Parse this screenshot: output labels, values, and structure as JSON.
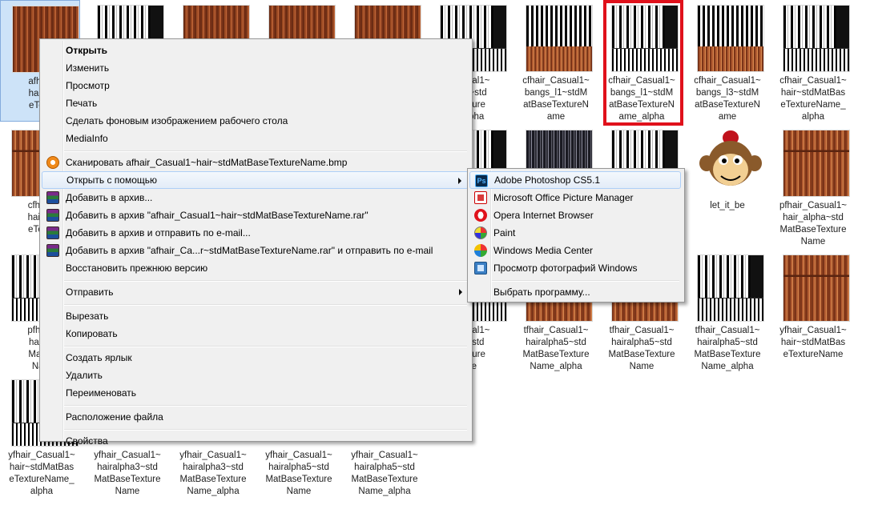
{
  "files": [
    {
      "col": 0,
      "row": 0,
      "name": "afhair_Casual1~hair~stdMatBaseTextureName",
      "caption": [
        "afhair_",
        "hair~st",
        "eTextu"
      ],
      "thumb": "hair",
      "selected": true
    },
    {
      "col": 1,
      "row": 0,
      "name": "",
      "caption": [],
      "thumb": "alpha"
    },
    {
      "col": 2,
      "row": 0,
      "name": "",
      "caption": [],
      "thumb": "hair"
    },
    {
      "col": 3,
      "row": 0,
      "name": "",
      "caption": [],
      "thumb": "hair"
    },
    {
      "col": 4,
      "row": 0,
      "name": "",
      "caption": [],
      "thumb": "hair"
    },
    {
      "col": 5,
      "row": 0,
      "name": "",
      "caption": [
        "Casual1~",
        "ha5~std",
        "Texture",
        "_alpha"
      ],
      "thumb": "alpha"
    },
    {
      "col": 6,
      "row": 0,
      "name": "cfhair_Casual1~bangs_l1~stdMatBaseTextureName",
      "caption": [
        "cfhair_Casual1~",
        "bangs_l1~stdM",
        "atBaseTextureN",
        "ame"
      ],
      "thumb": "mixed"
    },
    {
      "col": 7,
      "row": 0,
      "name": "cfhair_Casual1~bangs_l1~stdMatBaseTextureName_alpha",
      "caption": [
        "cfhair_Casual1~",
        "bangs_l1~stdM",
        "atBaseTextureN",
        "ame_alpha"
      ],
      "thumb": "alpha"
    },
    {
      "col": 8,
      "row": 0,
      "name": "cfhair_Casual1~bangs_l3~stdMatBaseTextureName",
      "caption": [
        "cfhair_Casual1~",
        "bangs_l3~stdM",
        "atBaseTextureN",
        "ame"
      ],
      "thumb": "mixed"
    },
    {
      "col": 9,
      "row": 0,
      "name": "cfhair_Casual1~hair~stdMatBaseTextureName_alpha",
      "caption": [
        "cfhair_Casual1~",
        "hair~stdMatBas",
        "eTextureName_",
        "alpha"
      ],
      "thumb": "alpha"
    },
    {
      "col": 0,
      "row": 1,
      "name": "",
      "caption": [
        "cfhair_",
        "hair~st",
        "eTextu"
      ],
      "thumb": "hair2"
    },
    {
      "col": 5,
      "row": 1,
      "name": "",
      "caption": [],
      "thumb": "alpha"
    },
    {
      "col": 6,
      "row": 1,
      "name": "",
      "caption": [],
      "thumb": "dark"
    },
    {
      "col": 7,
      "row": 1,
      "name": "",
      "caption": [],
      "thumb": "alpha"
    },
    {
      "col": 8,
      "row": 1,
      "name": "let_it_be",
      "caption": [
        "let_it_be"
      ],
      "thumb": "monkey"
    },
    {
      "col": 9,
      "row": 1,
      "name": "pfhair_Casual1~hair_alpha~stdMatBaseTextureName",
      "caption": [
        "pfhair_Casual1~",
        "hair_alpha~std",
        "MatBaseTexture",
        "Name"
      ],
      "thumb": "hair2"
    },
    {
      "col": 0,
      "row": 2,
      "name": "",
      "caption": [
        "pfhair_",
        "hair_a",
        "MatBa",
        "Nam"
      ],
      "thumb": "alpha"
    },
    {
      "col": 5,
      "row": 2,
      "name": "",
      "caption": [
        "Casual1~",
        "a3~std",
        "Texture",
        "me"
      ],
      "thumb": "alpha"
    },
    {
      "col": 6,
      "row": 2,
      "name": "tfhair_Casual1~hairalpha5~stdMatBaseTextureName_alpha",
      "caption": [
        "tfhair_Casual1~",
        "hairalpha5~std",
        "MatBaseTexture",
        "Name_alpha"
      ],
      "thumb": "hair2"
    },
    {
      "col": 7,
      "row": 2,
      "name": "tfhair_Casual1~hairalpha5~stdMatBaseTextureName",
      "caption": [
        "tfhair_Casual1~",
        "hairalpha5~std",
        "MatBaseTexture",
        "Name"
      ],
      "thumb": "hair2"
    },
    {
      "col": 8,
      "row": 2,
      "name": "tfhair_Casual1~hairalpha5~stdMatBaseTextureName_alpha",
      "caption": [
        "tfhair_Casual1~",
        "hairalpha5~std",
        "MatBaseTexture",
        "Name_alpha"
      ],
      "thumb": "alpha"
    },
    {
      "col": 9,
      "row": 2,
      "name": "yfhair_Casual1~hair~stdMatBaseTextureName",
      "caption": [
        "yfhair_Casual1~",
        "hair~stdMatBas",
        "eTextureName"
      ],
      "thumb": "hair2"
    },
    {
      "col": 0,
      "row": 3,
      "name": "yfhair_Casual1~hair~stdMatBaseTextureName_alpha",
      "caption": [
        "yfhair_Casual1~",
        "hair~stdMatBas",
        "eTextureName_",
        "alpha"
      ],
      "thumb": "alpha"
    },
    {
      "col": 1,
      "row": 3,
      "name": "yfhair_Casual1~hairalpha3~stdMatBaseTextureName",
      "caption": [
        "yfhair_Casual1~",
        "hairalpha3~std",
        "MatBaseTexture",
        "Name"
      ],
      "thumb": "none"
    },
    {
      "col": 2,
      "row": 3,
      "name": "yfhair_Casual1~hairalpha3~stdMatBaseTextureName_alpha",
      "caption": [
        "yfhair_Casual1~",
        "hairalpha3~std",
        "MatBaseTexture",
        "Name_alpha"
      ],
      "thumb": "none"
    },
    {
      "col": 3,
      "row": 3,
      "name": "yfhair_Casual1~hairalpha5~stdMatBaseTextureName",
      "caption": [
        "yfhair_Casual1~",
        "hairalpha5~std",
        "MatBaseTexture",
        "Name"
      ],
      "thumb": "none"
    },
    {
      "col": 4,
      "row": 3,
      "name": "yfhair_Casual1~hairalpha5~stdMatBaseTextureName_alpha",
      "caption": [
        "yfhair_Casual1~",
        "hairalpha5~std",
        "MatBaseTexture",
        "Name_alpha"
      ],
      "thumb": "none"
    }
  ],
  "context_menu": {
    "items": [
      {
        "label": "Открыть",
        "bold": true,
        "icon": ""
      },
      {
        "label": "Изменить",
        "icon": ""
      },
      {
        "label": "Просмотр",
        "icon": ""
      },
      {
        "label": "Печать",
        "icon": ""
      },
      {
        "label": "Сделать фоновым изображением рабочего стола",
        "icon": ""
      },
      {
        "label": "MediaInfo",
        "icon": ""
      },
      {
        "sep": true
      },
      {
        "label": "Сканировать afhair_Casual1~hair~stdMatBaseTextureName.bmp",
        "icon": "scan-icon"
      },
      {
        "label": "Открыть с помощью",
        "icon": "",
        "submenu": true,
        "highlighted": true
      },
      {
        "label": "Добавить в архив...",
        "icon": "winrar-icon"
      },
      {
        "label": "Добавить в архив \"afhair_Casual1~hair~stdMatBaseTextureName.rar\"",
        "icon": "winrar-icon"
      },
      {
        "label": "Добавить в архив и отправить по e-mail...",
        "icon": "winrar-icon"
      },
      {
        "label": "Добавить в архив \"afhair_Ca...r~stdMatBaseTextureName.rar\" и отправить по e-mail",
        "icon": "winrar-icon"
      },
      {
        "label": "Восстановить прежнюю версию",
        "icon": ""
      },
      {
        "sep": true
      },
      {
        "label": "Отправить",
        "icon": "",
        "submenu": true
      },
      {
        "sep": true
      },
      {
        "label": "Вырезать",
        "icon": ""
      },
      {
        "label": "Копировать",
        "icon": ""
      },
      {
        "sep": true
      },
      {
        "label": "Создать ярлык",
        "icon": ""
      },
      {
        "label": "Удалить",
        "icon": ""
      },
      {
        "label": "Переименовать",
        "icon": ""
      },
      {
        "sep": true
      },
      {
        "label": "Расположение файла",
        "icon": ""
      },
      {
        "sep": true
      },
      {
        "label": "Свойства",
        "icon": ""
      }
    ]
  },
  "open_with_submenu": {
    "items": [
      {
        "label": "Adobe Photoshop CS5.1",
        "icon": "photoshop-icon",
        "highlighted": true
      },
      {
        "label": "Microsoft Office Picture Manager",
        "icon": "picture-manager-icon"
      },
      {
        "label": "Opera Internet Browser",
        "icon": "opera-icon"
      },
      {
        "label": "Paint",
        "icon": "paint-icon"
      },
      {
        "label": "Windows Media Center",
        "icon": "media-center-icon"
      },
      {
        "label": "Просмотр фотографий Windows",
        "icon": "photo-viewer-icon"
      },
      {
        "sep": true
      },
      {
        "label": "Выбрать программу...",
        "icon": ""
      }
    ]
  },
  "highlight_color": "#e0111b"
}
